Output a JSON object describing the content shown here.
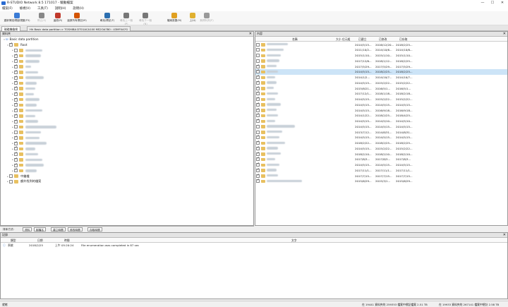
{
  "app": {
    "title": "R-STUDIO Network 8.5 171017 - 驅動檔案",
    "minimize": "—",
    "maximize": "☐",
    "close": "✕"
  },
  "menu": [
    "檔案(F)",
    "檢視(V)",
    "工具(T)",
    "說明(H)",
    "說明(H)"
  ],
  "toolbar": [
    {
      "label": "重新掃描/開啟視圖(F5)",
      "color": "#3a7bd5",
      "disabled": false
    },
    {
      "label": "停止(S)",
      "color": "#888",
      "disabled": true
    },
    {
      "label": "還原(R)",
      "color": "#c0392b",
      "disabled": false
    },
    {
      "label": "還原所有標記(M)",
      "color": "#d35400",
      "disabled": false
    },
    {
      "label": "尋找/標記(F)",
      "color": "#2c6fb0",
      "disabled": false
    },
    {
      "label": "尋找上一個(P)",
      "color": "#777",
      "disabled": true
    },
    {
      "label": "尋找下一個(N)",
      "color": "#777",
      "disabled": true
    },
    {
      "label": "檔案遮罩(M)",
      "color": "#e0a020",
      "disabled": false
    },
    {
      "label": "上(U)",
      "color": "#e0b030",
      "disabled": false
    },
    {
      "label": "無資料夾(F)",
      "color": "#999",
      "disabled": true
    }
  ],
  "tabs": [
    "磁碟機檢視",
    "Hh Basic data partition > TOSHIBA DT01ACA100 MS2OA7B0 : 43MF0A7G"
  ],
  "tree": {
    "header": "資料夾",
    "root_label": "Basic data partition",
    "root_folder": "Root",
    "folders": [
      {
        "checked": false,
        "w": 24
      },
      {
        "checked": true,
        "w": 22
      },
      {
        "checked": true,
        "w": 20
      },
      {
        "checked": true,
        "w": 8
      },
      {
        "checked": true,
        "w": 18
      },
      {
        "checked": true,
        "w": 26
      },
      {
        "checked": true,
        "w": 16
      },
      {
        "checked": true,
        "w": 14
      },
      {
        "checked": true,
        "w": 12
      },
      {
        "checked": true,
        "w": 20
      },
      {
        "checked": true,
        "w": 16
      },
      {
        "checked": true,
        "w": 24
      },
      {
        "checked": true,
        "w": 14
      },
      {
        "checked": true,
        "w": 18
      },
      {
        "checked": false,
        "w": 44
      },
      {
        "checked": false,
        "w": 22
      },
      {
        "checked": true,
        "w": 20
      },
      {
        "checked": true,
        "w": 30
      },
      {
        "checked": true,
        "w": 14
      },
      {
        "checked": true,
        "w": 18
      },
      {
        "checked": true,
        "w": 24
      },
      {
        "checked": true,
        "w": 26
      },
      {
        "checked": true,
        "w": 16
      }
    ],
    "extra": [
      {
        "label": "中繼檔",
        "checked": false
      },
      {
        "label": "額外找到的檔案",
        "checked": false
      }
    ]
  },
  "files": {
    "header": "內容",
    "columns": [
      "名稱",
      "大小",
      "位元組",
      "已建立",
      "已修改",
      "已存取"
    ],
    "rows": [
      {
        "checked": false,
        "w": 30,
        "c": "2014/5/15...",
        "m": "2016/12/20...",
        "a": "2018/2/25..."
      },
      {
        "checked": false,
        "w": 24,
        "c": "2011/10/2...",
        "m": "2014/10/6...",
        "a": "2014/10/6..."
      },
      {
        "checked": false,
        "w": 20,
        "c": "2015/1/10...",
        "m": "2015/1/10...",
        "a": "2015/1/10..."
      },
      {
        "checked": false,
        "w": 18,
        "c": "2017/12/6...",
        "m": "2018/1/12...",
        "a": "2018/2/25..."
      },
      {
        "checked": true,
        "w": 14,
        "c": "2017/5/29...",
        "m": "2017/5/29...",
        "a": "2017/5/29..."
      },
      {
        "checked": true,
        "w": 16,
        "c": "2014/5/15...",
        "m": "2018/2/25...",
        "a": "2018/2/25...",
        "sel": true
      },
      {
        "checked": true,
        "w": 12,
        "c": "2014/1/2...",
        "m": "2014/10/7...",
        "a": "2014/10/7..."
      },
      {
        "checked": true,
        "w": 14,
        "c": "2014/5/15...",
        "m": "2015/2/22...",
        "a": "2015/2/22..."
      },
      {
        "checked": true,
        "w": 10,
        "c": "2015/8/21...",
        "m": "2016/5/1...",
        "a": "2016/5/1..."
      },
      {
        "checked": true,
        "w": 16,
        "c": "2017/12/1...",
        "m": "2018/1/18...",
        "a": "2018/2/18..."
      },
      {
        "checked": true,
        "w": 12,
        "c": "2014/5/15...",
        "m": "2015/2/22...",
        "a": "2015/2/22..."
      },
      {
        "checked": true,
        "w": 20,
        "c": "2014/5/15...",
        "m": "2014/5/15...",
        "a": "2014/5/15..."
      },
      {
        "checked": true,
        "w": 14,
        "c": "2014/5/15...",
        "m": "2016/9/18...",
        "a": "2016/9/18..."
      },
      {
        "checked": true,
        "w": 16,
        "c": "2014/1/22...",
        "m": "2018/2/25...",
        "a": "2018/4/25..."
      },
      {
        "checked": true,
        "w": 12,
        "c": "2014/5/15...",
        "m": "2014/5/10...",
        "a": "2014/5/10..."
      },
      {
        "checked": false,
        "w": 40,
        "c": "2014/5/15...",
        "m": "2014/5/15...",
        "a": "2014/5/15..."
      },
      {
        "checked": false,
        "w": 22,
        "c": "2013/7/12...",
        "m": "2014/8/31...",
        "a": "2014/8/31..."
      },
      {
        "checked": true,
        "w": 18,
        "c": "2014/5/15...",
        "m": "2014/5/15...",
        "a": "2014/5/15..."
      },
      {
        "checked": true,
        "w": 26,
        "c": "2018/2/22...",
        "m": "2018/2/25...",
        "a": "2018/2/25..."
      },
      {
        "checked": true,
        "w": 16,
        "c": "2014/5/15...",
        "m": "2015/2/22...",
        "a": "2015/2/22..."
      },
      {
        "checked": true,
        "w": 20,
        "c": "2018/2/10...",
        "m": "2018/2/10...",
        "a": "2018/2/10..."
      },
      {
        "checked": true,
        "w": 12,
        "c": "2017/8/3...",
        "m": "2017/8/3...",
        "a": "2017/8/3..."
      },
      {
        "checked": true,
        "w": 18,
        "c": "2014/5/15...",
        "m": "2014/5/15...",
        "a": "2014/5/15..."
      },
      {
        "checked": true,
        "w": 14,
        "c": "2017/11/1...",
        "m": "2017/11/1...",
        "a": "2017/11/1..."
      },
      {
        "checked": true,
        "w": 16,
        "c": "2017/7/15...",
        "m": "2017/7/15...",
        "a": "2017/7/15..."
      },
      {
        "checked": true,
        "w": 50,
        "c": "2015/6/29...",
        "m": "2015/3/1...",
        "a": "2015/6/29..."
      }
    ]
  },
  "bottom_tabs": {
    "label": "排序方式：",
    "items": [
      "資料",
      "副檔名",
      "建立時間",
      "修改時間",
      "存取時間"
    ]
  },
  "log": {
    "header": "記錄",
    "columns": [
      "類型",
      "日期",
      "時間",
      "文字"
    ],
    "rows": [
      {
        "type": "系統",
        "date": "2018/2/25",
        "time": "上午 05:20:24",
        "text": "File enumeration was completed in 87 sec"
      }
    ]
  },
  "status": {
    "left": "就緒",
    "mid": "在 19441 資料夾的 259353 檔案中標記檔案 2.51 TB",
    "right": "在 19933 資料夾的 267141 檔案中總計 2.58 TB"
  }
}
